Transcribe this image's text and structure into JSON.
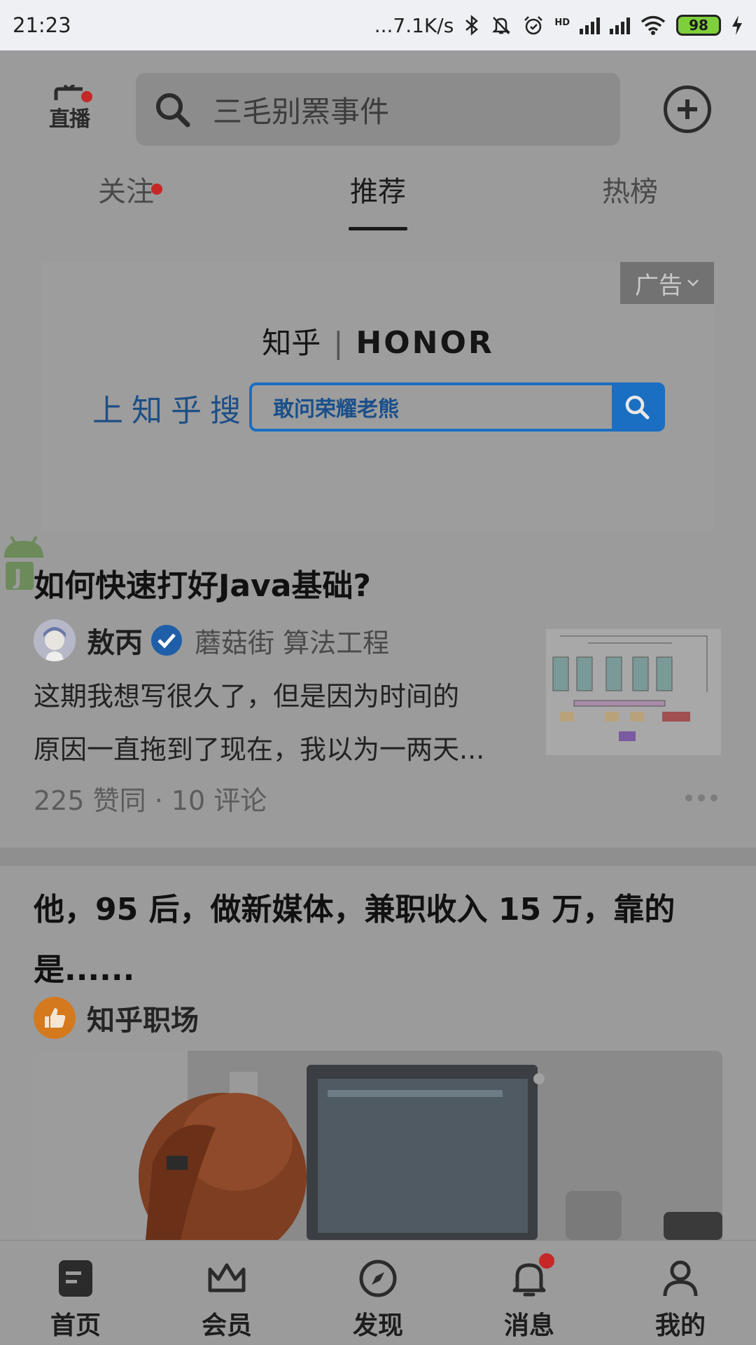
{
  "status_bar": {
    "time": "21:23",
    "net_speed": "...7.1K/s",
    "network_type": "HD",
    "battery": "98",
    "icons": [
      "bluetooth-icon",
      "mute-icon",
      "alarm-icon",
      "signal-icon",
      "signal-icon",
      "wifi-icon",
      "battery-icon",
      "charging-icon"
    ]
  },
  "top_bar": {
    "live_label": "直播",
    "search_placeholder": "三毛别罴事件",
    "icons": [
      "tv-icon",
      "search-icon",
      "add-icon"
    ]
  },
  "tabs": [
    {
      "label": "关注",
      "has_dot": true
    },
    {
      "label": "推荐",
      "active": true
    },
    {
      "label": "热榜"
    }
  ],
  "ad": {
    "badge": "广告",
    "brand_left": "知乎",
    "brand_right": "HONOR",
    "search_label": "上知乎搜",
    "search_query": "敢问荣耀老熊",
    "colors": {
      "blue": "#1a6fc2",
      "label_blue": "#1d4f86"
    }
  },
  "feed": [
    {
      "title": "如何快速打好Java基础?",
      "author": "敖丙",
      "author_desc": "蘑菇街 算法工程",
      "excerpt_line1": "这期我想写很久了，但是因为时间的",
      "excerpt_line2": "原因一直拖到了现在，我以为一两天...",
      "stats": "225 赞同 · 10 评论"
    },
    {
      "title": "他，95 后，做新媒体，兼职收入 15 万，靠的是......",
      "author": "知乎职场"
    }
  ],
  "bottom_nav": [
    {
      "label": "首页",
      "icon": "home-icon"
    },
    {
      "label": "会员",
      "icon": "crown-icon"
    },
    {
      "label": "发现",
      "icon": "compass-icon"
    },
    {
      "label": "消息",
      "icon": "bell-icon",
      "has_dot": true
    },
    {
      "label": "我的",
      "icon": "profile-icon"
    }
  ],
  "colors": {
    "overlay_gray": "#9b9b9b",
    "dot_red": "#c62828",
    "verified_blue": "#1f5ea8"
  }
}
